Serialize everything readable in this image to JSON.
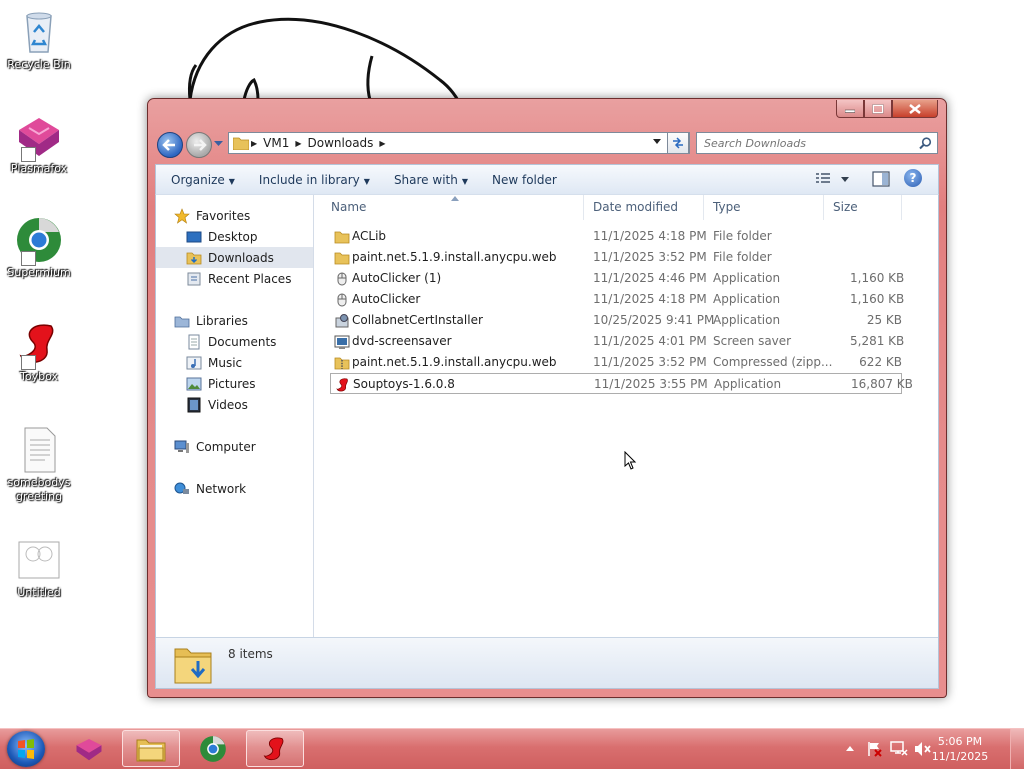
{
  "desktop": {
    "icons": [
      {
        "label": "Recycle Bin",
        "icon": "recycle-bin-icon"
      },
      {
        "label": "Plasmafox",
        "icon": "plasmafox-icon"
      },
      {
        "label": "Supermium",
        "icon": "supermium-icon"
      },
      {
        "label": "Toybox",
        "icon": "toybox-icon"
      },
      {
        "label": "somebodys greeting",
        "label_line1": "somebodys",
        "label_line2": "greeting",
        "icon": "text-file-icon"
      },
      {
        "label": "Untitled",
        "icon": "untitled-image-icon"
      }
    ]
  },
  "explorer": {
    "breadcrumb": [
      "VM1",
      "Downloads"
    ],
    "search": {
      "placeholder": "Search Downloads"
    },
    "toolbar": {
      "organize": "Organize",
      "include_in_library": "Include in library",
      "share_with": "Share with",
      "new_folder": "New folder"
    },
    "nav": {
      "favorites": {
        "label": "Favorites",
        "items": [
          "Desktop",
          "Downloads",
          "Recent Places"
        ],
        "selected": "Downloads"
      },
      "libraries": {
        "label": "Libraries",
        "items": [
          "Documents",
          "Music",
          "Pictures",
          "Videos"
        ]
      },
      "computer": "Computer",
      "network": "Network"
    },
    "columns": {
      "name": "Name",
      "date_modified": "Date modified",
      "type": "Type",
      "size": "Size"
    },
    "files": [
      {
        "name": "ACLib",
        "date": "11/1/2025 4:18 PM",
        "type": "File folder",
        "size": "",
        "icon": "folder-icon"
      },
      {
        "name": "paint.net.5.1.9.install.anycpu.web",
        "date": "11/1/2025 3:52 PM",
        "type": "File folder",
        "size": "",
        "icon": "folder-icon"
      },
      {
        "name": "AutoClicker (1)",
        "date": "11/1/2025 4:46 PM",
        "type": "Application",
        "size": "1,160 KB",
        "icon": "mouse-icon"
      },
      {
        "name": "AutoClicker",
        "date": "11/1/2025 4:18 PM",
        "type": "Application",
        "size": "1,160 KB",
        "icon": "mouse-icon"
      },
      {
        "name": "CollabnetCertInstaller",
        "date": "10/25/2025 9:41 PM",
        "type": "Application",
        "size": "25 KB",
        "icon": "installer-icon"
      },
      {
        "name": "dvd-screensaver",
        "date": "11/1/2025 4:01 PM",
        "type": "Screen saver",
        "size": "5,281 KB",
        "icon": "screensaver-icon"
      },
      {
        "name": "paint.net.5.1.9.install.anycpu.web",
        "date": "11/1/2025 3:52 PM",
        "type": "Compressed (zipp...",
        "size": "622 KB",
        "icon": "zip-folder-icon"
      },
      {
        "name": "Souptoys-1.6.0.8",
        "date": "11/1/2025 3:55 PM",
        "type": "Application",
        "size": "16,807 KB",
        "icon": "souptoys-icon"
      }
    ],
    "selected_file": "Souptoys-1.6.0.8",
    "status": {
      "item_count": "8 items"
    }
  },
  "taskbar": {
    "clock": {
      "time": "5:06 PM",
      "date": "11/1/2025"
    },
    "buttons": [
      "plasmafox-icon",
      "explorer-icon",
      "supermium-icon",
      "toybox-icon"
    ]
  },
  "colors": {
    "window_frame": "#e58b8b",
    "taskbar": "#d96f6f",
    "selection": "#e1e6ee",
    "toolbar_text": "#1e395b"
  }
}
